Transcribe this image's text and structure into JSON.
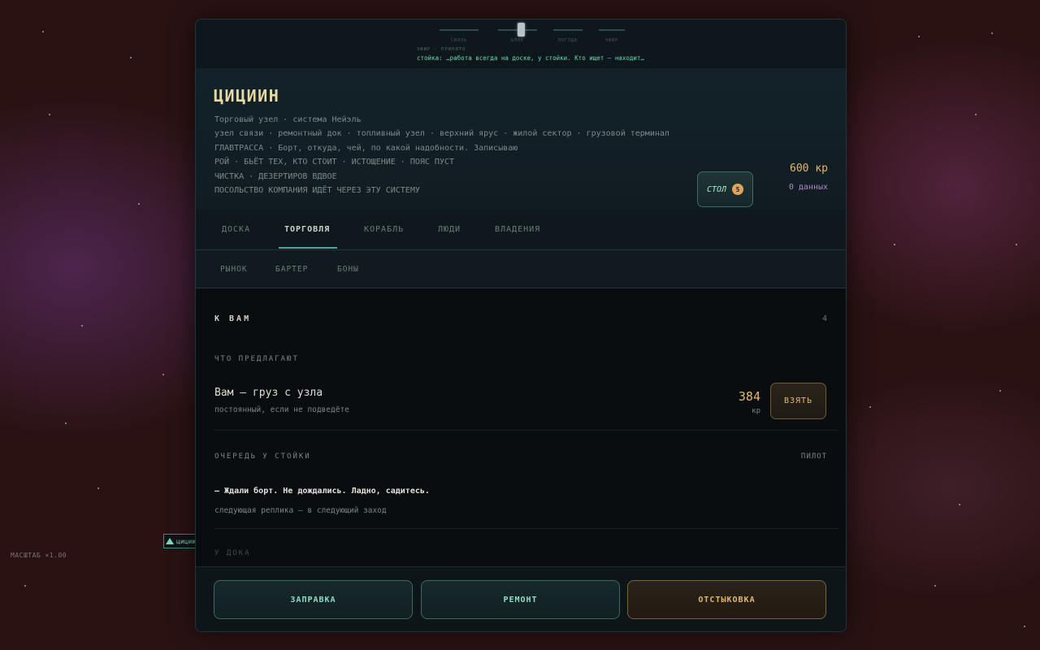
{
  "map": {
    "marker_label": "циции",
    "scale_label": "МАСШТАБ ×1.00"
  },
  "timeline": {
    "segments": [
      "СВЯЗЬ",
      "БЛОК",
      "ПОГОДА",
      "ЭФИР"
    ],
    "meta": "ЭФИР · ПРИНЯТО",
    "ticker": "стойка: …работа всегда на доске, у стойки. Кто ищет — находит…"
  },
  "station": {
    "name": "ЦИЦИИН",
    "lines": [
      "Торговый узел · система Нейэль",
      "узел связи · ремонтный док · топливный узел · верхний ярус · жилой сектор · грузовой терминал",
      "ГЛАВТРАССА · Борт, откуда, чей, по какой надобности. Записываю",
      "РОЙ · БЬЁТ ТЕХ, КТО СТОИТ · ИСТОЩЕНИЕ · ПОЯС ПУСТ",
      "ЧИСТКА · ДЕЗЕРТИРОВ ВДВОЕ",
      "ПОСОЛЬСТВО КОМПАНИЯ ИДЁТ ЧЕРЕЗ ЭТУ СИСТЕМУ"
    ],
    "stol_label": "СТОЛ",
    "stol_count": "5",
    "credits": "600 кр",
    "data_count": "0 данных"
  },
  "tabs": [
    "ДОСКА",
    "ТОРГОВЛЯ",
    "КОРАБЛЬ",
    "ЛЮДИ",
    "ВЛАДЕНИЯ"
  ],
  "active_tab": "ТОРГОВЛЯ",
  "subtabs": [
    "РЫНОК",
    "БАРТЕР",
    "БОНЫ"
  ],
  "content": {
    "section_title": "К ВАМ",
    "section_count": "4",
    "offer_label": "ЧТО ПРЕДЛАГАЮТ",
    "offer": {
      "title": "Вам — груз с узла",
      "subtitle": "постоянный, если не подведёте",
      "price": "384",
      "unit": "кр",
      "take_label": "ВЗЯТЬ"
    },
    "queue_label": "ОЧЕРЕДЬ У СТОЙКИ",
    "queue_role": "ПИЛОТ",
    "queue_line": "— Ждали борт. Не дождались. Ладно, садитесь.",
    "queue_next": "следующая реплика — в следующий заход",
    "dock_label": "У ДОКА"
  },
  "footer": {
    "refuel": "ЗАПРАВКА",
    "repair": "РЕМОНТ",
    "undock": "ОТСТЫКОВКА"
  },
  "colors": {
    "accent_teal": "#6fd6b8",
    "accent_amber": "#e3b868",
    "title_gold": "#e8d9a4",
    "data_purple": "#b28ac9"
  }
}
